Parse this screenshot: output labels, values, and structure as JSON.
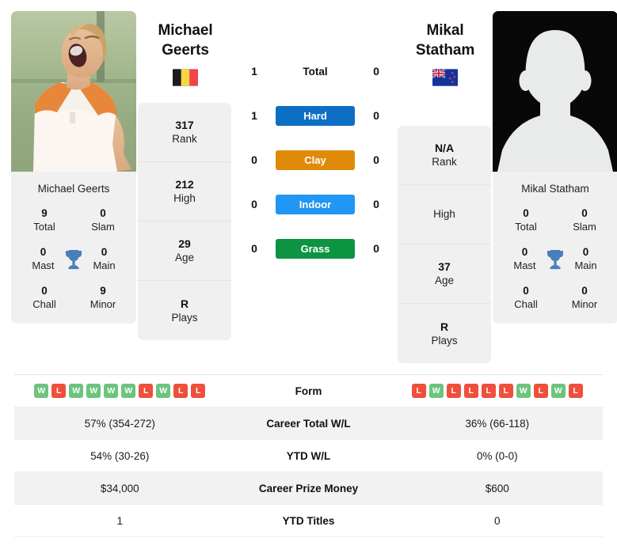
{
  "players": {
    "left": {
      "first_name": "Michael",
      "last_name": "Geerts",
      "full_name": "Michael Geerts",
      "photo_alt": "Michael Geerts",
      "country": "Belgium",
      "flag": "belgium-flag",
      "rank": "317",
      "rank_label": "Rank",
      "high": "212",
      "high_label": "High",
      "age": "29",
      "age_label": "Age",
      "plays": "R",
      "plays_label": "Plays",
      "titles": {
        "total": "9",
        "total_label": "Total",
        "slam": "0",
        "slam_label": "Slam",
        "mast": "0",
        "mast_label": "Mast",
        "main": "0",
        "main_label": "Main",
        "chall": "0",
        "chall_label": "Chall",
        "minor": "9",
        "minor_label": "Minor"
      },
      "form": [
        "W",
        "L",
        "W",
        "W",
        "W",
        "W",
        "L",
        "W",
        "L",
        "L"
      ],
      "career_total_wl": "57% (354-272)",
      "ytd_wl": "54% (30-26)",
      "career_prize_money": "$34,000",
      "ytd_titles": "1"
    },
    "right": {
      "first_name": "Mikal",
      "last_name": "Statham",
      "full_name": "Mikal Statham",
      "photo_alt": "Mikal Statham",
      "country": "New Zealand",
      "flag": "new-zealand-flag",
      "rank": "N/A",
      "rank_label": "Rank",
      "high": "",
      "high_label": "High",
      "age": "37",
      "age_label": "Age",
      "plays": "R",
      "plays_label": "Plays",
      "titles": {
        "total": "0",
        "total_label": "Total",
        "slam": "0",
        "slam_label": "Slam",
        "mast": "0",
        "mast_label": "Mast",
        "main": "0",
        "main_label": "Main",
        "chall": "0",
        "chall_label": "Chall",
        "minor": "0",
        "minor_label": "Minor"
      },
      "form": [
        "L",
        "W",
        "L",
        "L",
        "L",
        "L",
        "W",
        "L",
        "W",
        "L"
      ],
      "career_total_wl": "36% (66-118)",
      "ytd_wl": "0% (0-0)",
      "career_prize_money": "$600",
      "ytd_titles": "0"
    }
  },
  "head_to_head": [
    {
      "label": "Total",
      "left": "1",
      "right": "0",
      "badge": false,
      "color": ""
    },
    {
      "label": "Hard",
      "left": "1",
      "right": "0",
      "badge": true,
      "color": "#0d6fc4"
    },
    {
      "label": "Clay",
      "left": "0",
      "right": "0",
      "badge": true,
      "color": "#e08a0a"
    },
    {
      "label": "Indoor",
      "left": "0",
      "right": "0",
      "badge": true,
      "color": "#2196f3"
    },
    {
      "label": "Grass",
      "left": "0",
      "right": "0",
      "badge": true,
      "color": "#0d9442"
    }
  ],
  "stats_table": [
    {
      "label": "Form",
      "left": "",
      "right": "",
      "type": "form"
    },
    {
      "label": "Career Total W/L",
      "left": "57% (354-272)",
      "right": "36% (66-118)",
      "type": "text"
    },
    {
      "label": "YTD W/L",
      "left": "54% (30-26)",
      "right": "0% (0-0)",
      "type": "text"
    },
    {
      "label": "Career Prize Money",
      "left": "$34,000",
      "right": "$600",
      "type": "text"
    },
    {
      "label": "YTD Titles",
      "left": "1",
      "right": "0",
      "type": "text"
    }
  ],
  "icons": {
    "trophy": "trophy-icon"
  },
  "colors": {
    "hard": "#0d6fc4",
    "clay": "#e08a0a",
    "indoor": "#2196f3",
    "grass": "#0d9442",
    "win": "#6cc47e",
    "loss": "#ef4f3b",
    "trophy": "#4a7ebb",
    "card_bg": "#f0f0f0"
  }
}
